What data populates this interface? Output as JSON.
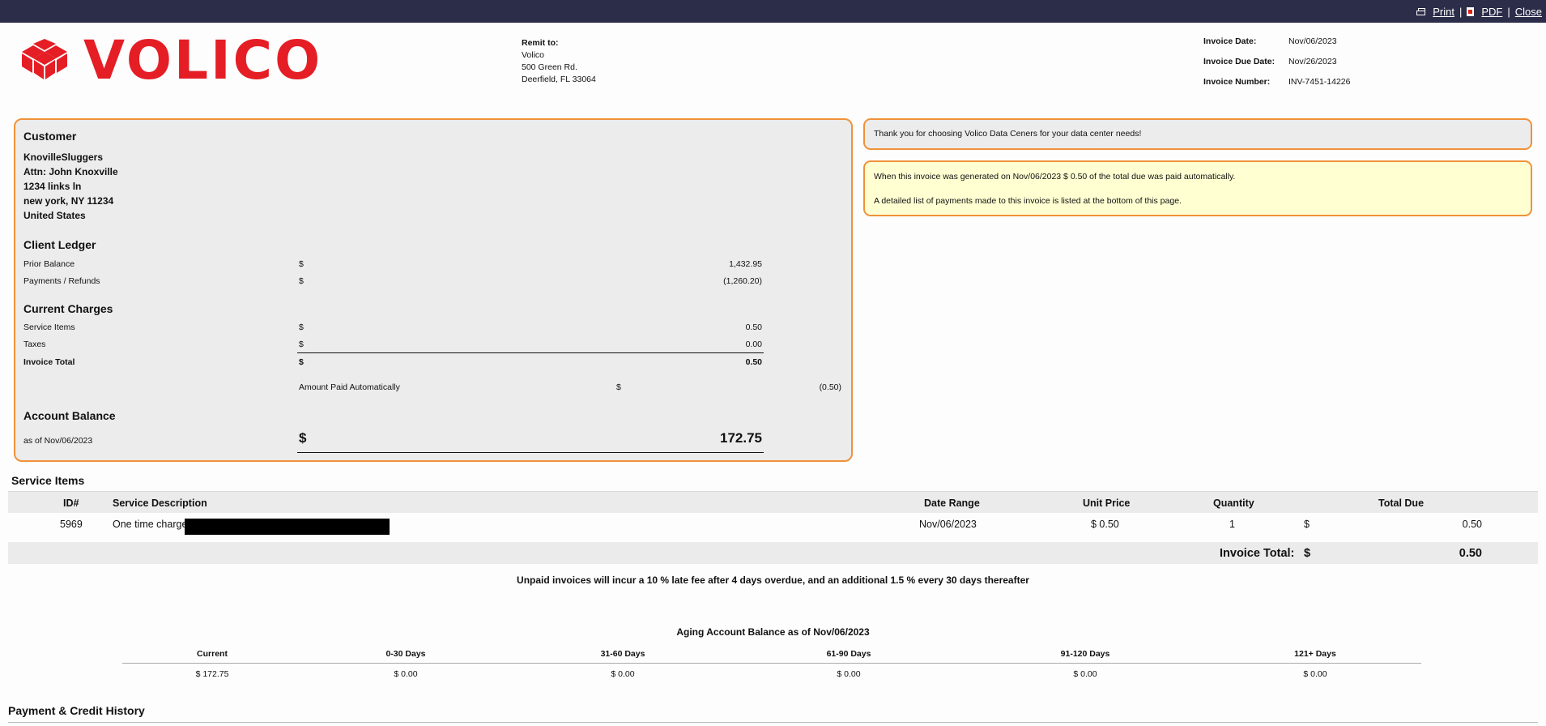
{
  "toolbar": {
    "print": "Print",
    "pdf": "PDF",
    "close": "Close",
    "sep": "|"
  },
  "brand": {
    "name": "VOLICO",
    "color": "#e51d25"
  },
  "remit": {
    "label": "Remit to:",
    "lines": [
      "Volico",
      "500 Green Rd.",
      "Deerfield, FL 33064"
    ]
  },
  "invoice_meta": {
    "date_label": "Invoice Date:",
    "date": "Nov/06/2023",
    "due_label": "Invoice Due Date:",
    "due": "Nov/26/2023",
    "number_label": "Invoice Number:",
    "number": "INV-7451-14226"
  },
  "customer": {
    "heading": "Customer",
    "lines": [
      "KnovilleSluggers",
      "Attn: John Knoxville",
      "1234 links ln",
      "new york, NY 11234",
      "United States"
    ]
  },
  "ledger": {
    "heading": "Client Ledger",
    "prior_label": "Prior Balance",
    "prior_currency": "$",
    "prior_value": "1,432.95",
    "payments_label": "Payments / Refunds",
    "payments_currency": "$",
    "payments_value": "(1,260.20)"
  },
  "charges": {
    "heading": "Current Charges",
    "service_label": "Service Items",
    "service_currency": "$",
    "service_value": "0.50",
    "taxes_label": "Taxes",
    "taxes_currency": "$",
    "taxes_value": "0.00",
    "total_label": "Invoice Total",
    "total_currency": "$",
    "total_value": "0.50",
    "autopaid_label": "Amount Paid Automatically",
    "autopaid_currency": "$",
    "autopaid_value": "(0.50)"
  },
  "balance": {
    "heading": "Account Balance",
    "as_of": "as of Nov/06/2023",
    "currency": "$",
    "value": "172.75"
  },
  "messages": {
    "thanks": "Thank you for choosing Volico Data Ceners for your data center needs!",
    "auto_paid": "When this invoice was generated on Nov/06/2023 $ 0.50 of the total due was paid automatically.",
    "payment_list": "A detailed list of payments made to this invoice is listed at the bottom of this page."
  },
  "service_items": {
    "title": "Service Items",
    "columns": [
      "ID#",
      "Service Description",
      "Date Range",
      "Unit Price",
      "Quantity",
      "Total Due"
    ],
    "rows": [
      {
        "id": "5969",
        "description": "One time charge",
        "date_range": "Nov/06/2023",
        "unit_price": "$ 0.50",
        "quantity": "1",
        "currency": "$",
        "total": "0.50"
      }
    ],
    "invoice_total_label": "Invoice Total:",
    "invoice_total_currency": "$",
    "invoice_total": "0.50"
  },
  "notice": "Unpaid invoices will incur a 10 % late fee after 4 days overdue, and an additional 1.5 % every 30 days thereafter",
  "aging": {
    "title": "Aging Account Balance as of Nov/06/2023",
    "columns": [
      "Current",
      "0-30 Days",
      "31-60 Days",
      "61-90 Days",
      "91-120 Days",
      "121+ Days"
    ],
    "values": [
      "$ 172.75",
      "$ 0.00",
      "$ 0.00",
      "$ 0.00",
      "$ 0.00",
      "$ 0.00"
    ]
  },
  "payment_history": {
    "title": "Payment & Credit History"
  }
}
